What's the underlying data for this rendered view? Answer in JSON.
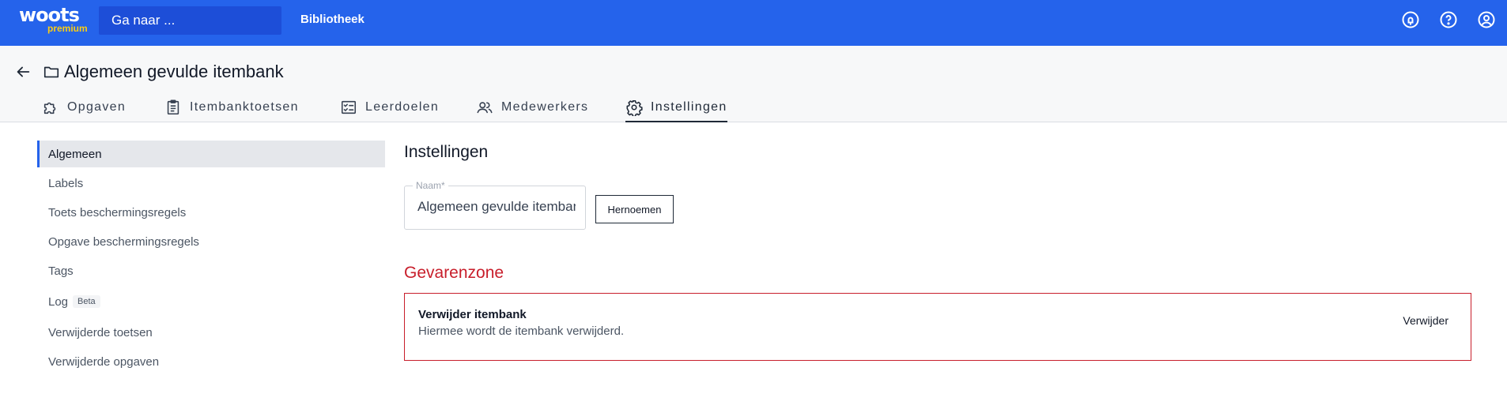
{
  "topbar": {
    "logo_word": "woots",
    "logo_sub": "premium",
    "search_placeholder": "Ga naar ...",
    "nav_library": "Bibliotheek",
    "icons": [
      "notifications-icon",
      "help-icon",
      "account-icon"
    ],
    "color": "#2563eb"
  },
  "header": {
    "title": "Algemeen gevulde itembank",
    "tabs": [
      {
        "label": "Opgaven",
        "icon": "puzzle-icon",
        "active": false
      },
      {
        "label": "Itembanktoetsen",
        "icon": "clipboard-icon",
        "active": false
      },
      {
        "label": "Leerdoelen",
        "icon": "checklist-icon",
        "active": false
      },
      {
        "label": "Medewerkers",
        "icon": "users-icon",
        "active": false
      },
      {
        "label": "Instellingen",
        "icon": "gear-icon",
        "active": true
      }
    ]
  },
  "sidebar": {
    "items": [
      {
        "label": "Algemeen",
        "active": true
      },
      {
        "label": "Labels"
      },
      {
        "label": "Toets beschermingsregels"
      },
      {
        "label": "Opgave beschermingsregels"
      },
      {
        "label": "Tags"
      },
      {
        "label": "Log",
        "badge": "Beta"
      },
      {
        "label": "Verwijderde toetsen"
      },
      {
        "label": "Verwijderde opgaven"
      }
    ]
  },
  "main": {
    "title": "Instellingen",
    "name_field": {
      "label": "Naam*",
      "value": "Algemeen gevulde itembank"
    },
    "rename_button": "Hernoemen",
    "danger": {
      "title": "Gevarenzone",
      "heading": "Verwijder itembank",
      "description": "Hiermee wordt de itembank verwijderd.",
      "button": "Verwijder",
      "color": "#c81e2b"
    }
  }
}
